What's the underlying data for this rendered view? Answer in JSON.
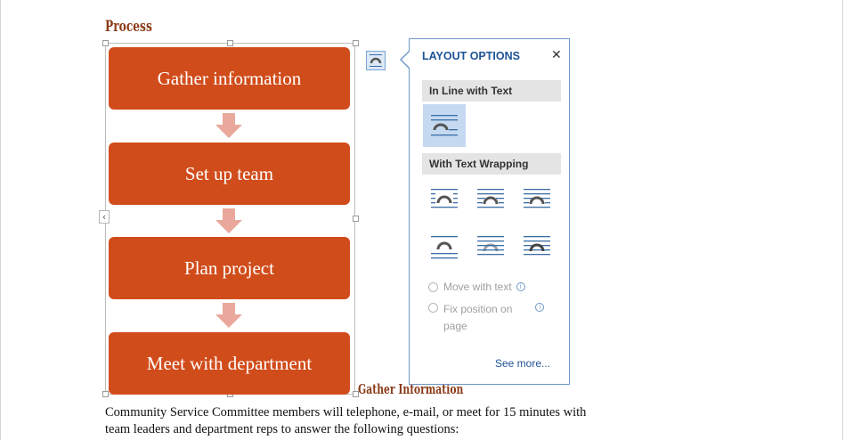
{
  "document": {
    "process_heading": "Process",
    "section_heading": "Gather Information",
    "body_lines": [
      "Community Service Committee members will telephone, e-mail, or meet for 15 minutes with",
      "team leaders and department reps to answer the following questions:"
    ]
  },
  "smartart": {
    "steps": [
      "Gather information",
      "Set up team",
      "Plan project",
      "Meet with department"
    ],
    "collapse_glyph": "‹",
    "box_color": "#d14c1b",
    "arrow_color": "#e9a89b"
  },
  "layout_options": {
    "title": "LAYOUT OPTIONS",
    "close_glyph": "✕",
    "inline_section": "In Line with Text",
    "wrapping_section": "With Text Wrapping",
    "move_with_text": "Move with text",
    "fix_position_line1": "Fix position on",
    "fix_position_line2": "page",
    "info_glyph": "i",
    "see_more": "See more...",
    "accent": "#1f5496",
    "options": [
      "in-line-with-text",
      "square",
      "tight",
      "through",
      "top-and-bottom",
      "behind-text",
      "in-front-of-text"
    ],
    "selected_option": "in-line-with-text"
  }
}
